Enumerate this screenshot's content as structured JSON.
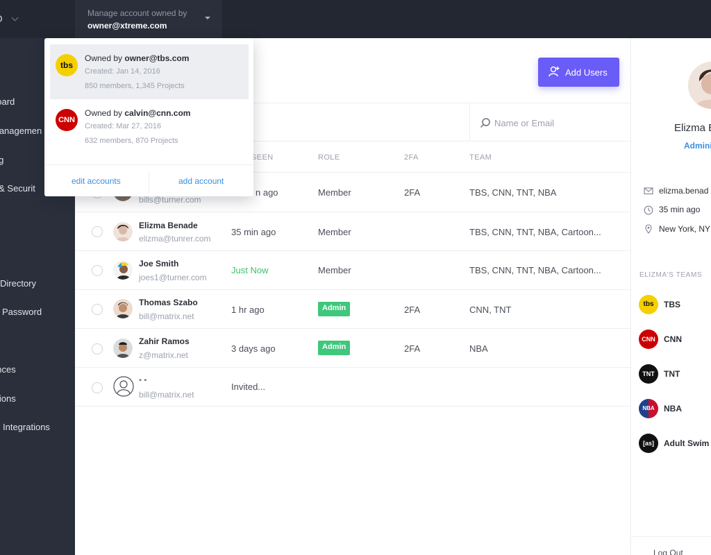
{
  "topbar": {
    "logo_text": "O",
    "account_switch_label": "Manage account owned by",
    "account_switch_value": "owner@xtreme.com"
  },
  "sidebar": {
    "items": [
      {
        "label": "board"
      },
      {
        "label": "Managemen"
      },
      {
        "label": "ing"
      },
      {
        "label": "s & Securit"
      },
      {
        "label": "Directory"
      },
      {
        "label": "Password"
      },
      {
        "label": "ences"
      },
      {
        "label": "ations"
      },
      {
        "label": "Integrations"
      }
    ]
  },
  "dropdown": {
    "accounts": [
      {
        "logo": "tbs",
        "owner_prefix": "Owned by ",
        "owner": "owner@tbs.com",
        "created": "Created: Jan 14, 2016",
        "counts": "850 members,  1,345 Projects"
      },
      {
        "logo": "CNN",
        "owner_prefix": "Owned by ",
        "owner": "calvin@cnn.com",
        "created": "Created: Mar 27, 2016",
        "counts": "632 members,  870 Projects"
      }
    ],
    "edit_label": "edit accounts",
    "add_label": "add account"
  },
  "main": {
    "add_users_label": "Add Users",
    "search_placeholder": "Name or Email",
    "columns": {
      "seen": "SEEN",
      "role": "ROLE",
      "tfa": "2FA",
      "team": "TEAM"
    },
    "rows": [
      {
        "name": "",
        "email": "bills@turner.com",
        "seen": "n ago",
        "role": "Member",
        "admin": false,
        "tfa": "2FA",
        "team": "TBS, CNN, TNT, NBA"
      },
      {
        "name": "Elizma Benade",
        "email": "elizma@tunrer.com",
        "seen": "35 min ago",
        "role": "Member",
        "admin": false,
        "tfa": "",
        "team": "TBS, CNN, TNT, NBA, Cartoon..."
      },
      {
        "name": "Joe Smith",
        "email": "joes1@turner.com",
        "seen": "Just Now",
        "role": "Member",
        "admin": false,
        "tfa": "",
        "team": "TBS, CNN, TNT, NBA, Cartoon..."
      },
      {
        "name": "Thomas Szabo",
        "email": "bill@matrix.net",
        "seen": "1 hr ago",
        "role": "Admin",
        "admin": true,
        "tfa": "2FA",
        "team": "CNN, TNT"
      },
      {
        "name": "Zahir Ramos",
        "email": "z@matrix.net",
        "seen": "3 days ago",
        "role": "Admin",
        "admin": true,
        "tfa": "2FA",
        "team": "NBA"
      },
      {
        "name": "- -",
        "email": "bill@matrix.net",
        "seen": "Invited...",
        "role": "",
        "admin": false,
        "tfa": "",
        "team": ""
      }
    ]
  },
  "profile": {
    "name": "Elizma B",
    "role": "Admini",
    "email": "elizma.benad",
    "last_seen": "35 min ago",
    "location": "New York, NY",
    "teams_heading": "ELIZMA'S TEAMS",
    "teams": [
      {
        "logo": "tbs",
        "name": "TBS"
      },
      {
        "logo": "CNN",
        "name": "CNN"
      },
      {
        "logo": "TNT",
        "name": "TNT"
      },
      {
        "logo": "NBA",
        "name": "NBA"
      },
      {
        "logo": "[as]",
        "name": "Adult Swim"
      }
    ],
    "logout_label": "Log Out"
  },
  "colors": {
    "topbar": "#232732",
    "sidebar": "#2a2f3b",
    "accent": "#6a5cf6",
    "link": "#3a8fe0",
    "admin_badge": "#3fc77c",
    "just_now": "#3ec26b"
  }
}
